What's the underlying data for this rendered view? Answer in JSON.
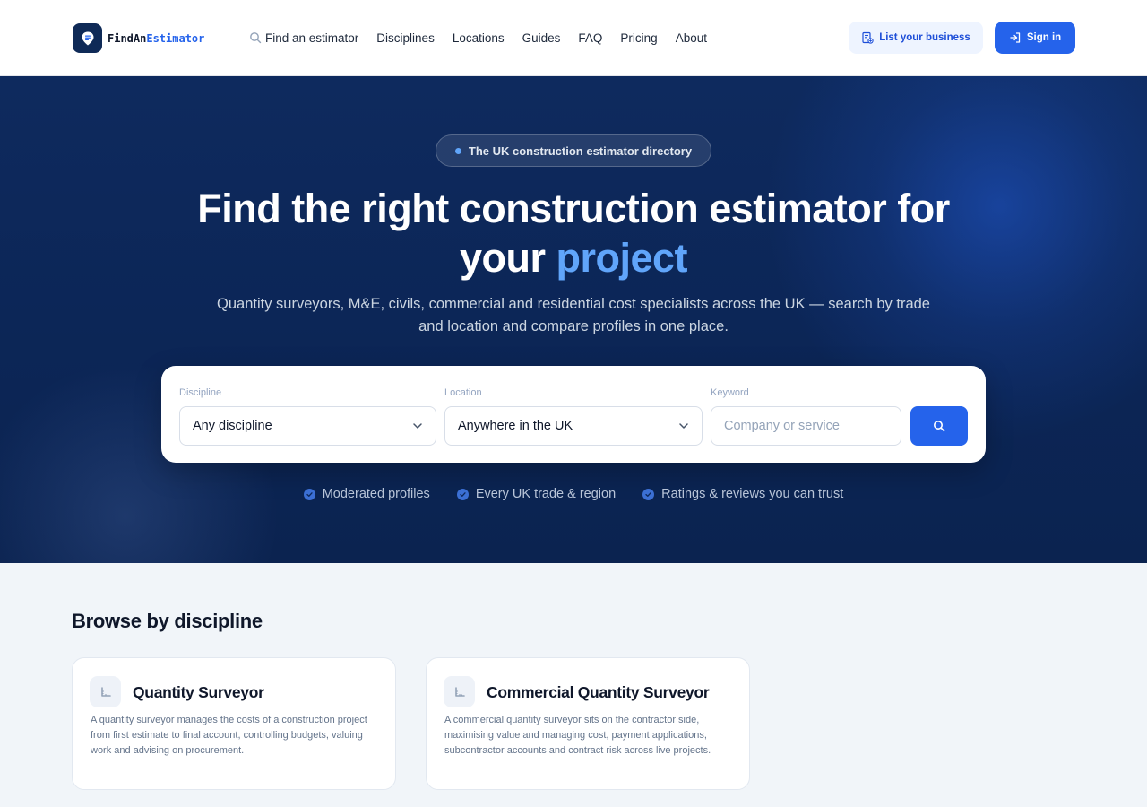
{
  "header": {
    "logo": {
      "part1": "FindAn",
      "part2": "Estimator"
    },
    "nav": [
      {
        "label": "Find an estimator",
        "icon": "search-icon"
      },
      {
        "label": "Disciplines"
      },
      {
        "label": "Locations"
      },
      {
        "label": "Guides"
      },
      {
        "label": "FAQ"
      },
      {
        "label": "Pricing"
      },
      {
        "label": "About"
      }
    ],
    "list_business_label": "List your business",
    "sign_in_label": "Sign in"
  },
  "hero": {
    "pill": "The UK construction estimator directory",
    "title_part1": "Find the right construction estimator for",
    "title_part2": "your",
    "title_accent": "project",
    "subtitle": "Quantity surveyors, M&E, civils, commercial and residential cost specialists across the UK — search by trade and location and compare profiles in one place."
  },
  "search": {
    "discipline_label": "Discipline",
    "discipline_value": "Any discipline",
    "location_label": "Location",
    "location_value": "Anywhere in the UK",
    "keyword_label": "Keyword",
    "keyword_placeholder": "Company or service"
  },
  "trust": [
    {
      "label": "Moderated profiles"
    },
    {
      "label": "Every UK trade & region"
    },
    {
      "label": "Ratings & reviews you can trust"
    }
  ],
  "browse": {
    "title": "Browse by discipline",
    "cards": [
      {
        "title": "Quantity Surveyor",
        "description": "A quantity surveyor manages the costs of a construction project from first estimate to final account, controlling budgets, valuing work and advising on procurement."
      },
      {
        "title": "Commercial Quantity Surveyor",
        "description": "A commercial quantity surveyor sits on the contractor side, maximising value and managing cost, payment applications, subcontractor accounts and contract risk across live projects."
      }
    ]
  },
  "colors": {
    "brand": "#2563eb",
    "navy": "#0e2a5e",
    "accent": "#60a5fa"
  }
}
